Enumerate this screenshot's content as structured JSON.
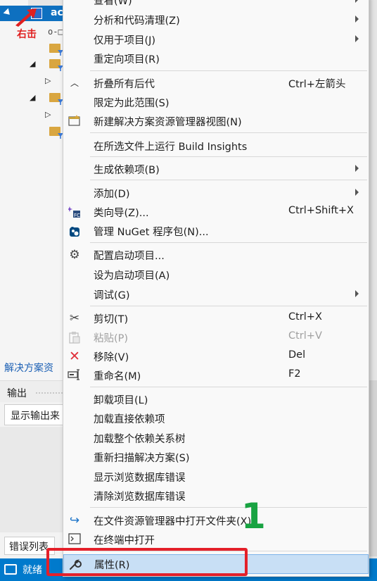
{
  "tree": {
    "project_label": "ac",
    "annotation_label": "右击"
  },
  "panels": {
    "solution_tab": "解决方案资",
    "output_title": "输出",
    "output_source": "显示输出来",
    "error_list_tab": "错误列表",
    "status_text": "就绪"
  },
  "menu": {
    "items": [
      {
        "label": "查看(W)",
        "shortcut": "",
        "icon": "",
        "submenu": true
      },
      {
        "label": "分析和代码清理(Z)",
        "shortcut": "",
        "icon": "",
        "submenu": true
      },
      {
        "label": "仅用于项目(J)",
        "shortcut": "",
        "icon": "",
        "submenu": true
      },
      {
        "label": "重定向项目(R)",
        "shortcut": "",
        "icon": "",
        "submenu": false
      },
      {
        "label": "折叠所有后代",
        "shortcut": "Ctrl+左箭头",
        "icon": "collapse-icon",
        "submenu": false
      },
      {
        "label": "限定为此范围(S)",
        "shortcut": "",
        "icon": "",
        "submenu": false
      },
      {
        "label": "新建解决方案资源管理器视图(N)",
        "shortcut": "",
        "icon": "new-view-icon",
        "submenu": false
      },
      {
        "label": "在所选文件上运行 Build Insights",
        "shortcut": "",
        "icon": "",
        "submenu": false
      },
      {
        "label": "生成依赖项(B)",
        "shortcut": "",
        "icon": "",
        "submenu": true
      },
      {
        "label": "添加(D)",
        "shortcut": "",
        "icon": "",
        "submenu": true
      },
      {
        "label": "类向导(Z)...",
        "shortcut": "Ctrl+Shift+X",
        "icon": "class-wizard-icon",
        "submenu": false
      },
      {
        "label": "管理 NuGet 程序包(N)...",
        "shortcut": "",
        "icon": "nuget-icon",
        "submenu": false
      },
      {
        "label": "配置启动项目...",
        "shortcut": "",
        "icon": "gear-icon",
        "submenu": false
      },
      {
        "label": "设为启动项目(A)",
        "shortcut": "",
        "icon": "",
        "submenu": false
      },
      {
        "label": "调试(G)",
        "shortcut": "",
        "icon": "",
        "submenu": true
      },
      {
        "label": "剪切(T)",
        "shortcut": "Ctrl+X",
        "icon": "scissors-icon",
        "submenu": false
      },
      {
        "label": "粘贴(P)",
        "shortcut": "Ctrl+V",
        "icon": "paste-icon",
        "submenu": false,
        "disabled": true
      },
      {
        "label": "移除(V)",
        "shortcut": "Del",
        "icon": "remove-icon",
        "submenu": false
      },
      {
        "label": "重命名(M)",
        "shortcut": "F2",
        "icon": "rename-icon",
        "submenu": false
      },
      {
        "label": "卸载项目(L)",
        "shortcut": "",
        "icon": "",
        "submenu": false
      },
      {
        "label": "加载直接依赖项",
        "shortcut": "",
        "icon": "",
        "submenu": false
      },
      {
        "label": "加载整个依赖关系树",
        "shortcut": "",
        "icon": "",
        "submenu": false
      },
      {
        "label": "重新扫描解决方案(S)",
        "shortcut": "",
        "icon": "",
        "submenu": false
      },
      {
        "label": "显示浏览数据库错误",
        "shortcut": "",
        "icon": "",
        "submenu": false
      },
      {
        "label": "清除浏览数据库错误",
        "shortcut": "",
        "icon": "",
        "submenu": false
      },
      {
        "label": "在文件资源管理器中打开文件夹(X)",
        "shortcut": "",
        "icon": "open-folder-icon",
        "submenu": false
      },
      {
        "label": "在终端中打开",
        "shortcut": "",
        "icon": "terminal-icon",
        "submenu": false
      },
      {
        "label": "属性(R)",
        "shortcut": "",
        "icon": "wrench-icon",
        "submenu": false,
        "highlighted": true
      }
    ]
  },
  "annotations": {
    "step_number": "1"
  },
  "colors": {
    "status_bar": "#007acc",
    "selection": "#0e70c0",
    "highlight": "#c8dff5",
    "annotation_red": "#e4202a",
    "annotation_green": "#19a342"
  }
}
